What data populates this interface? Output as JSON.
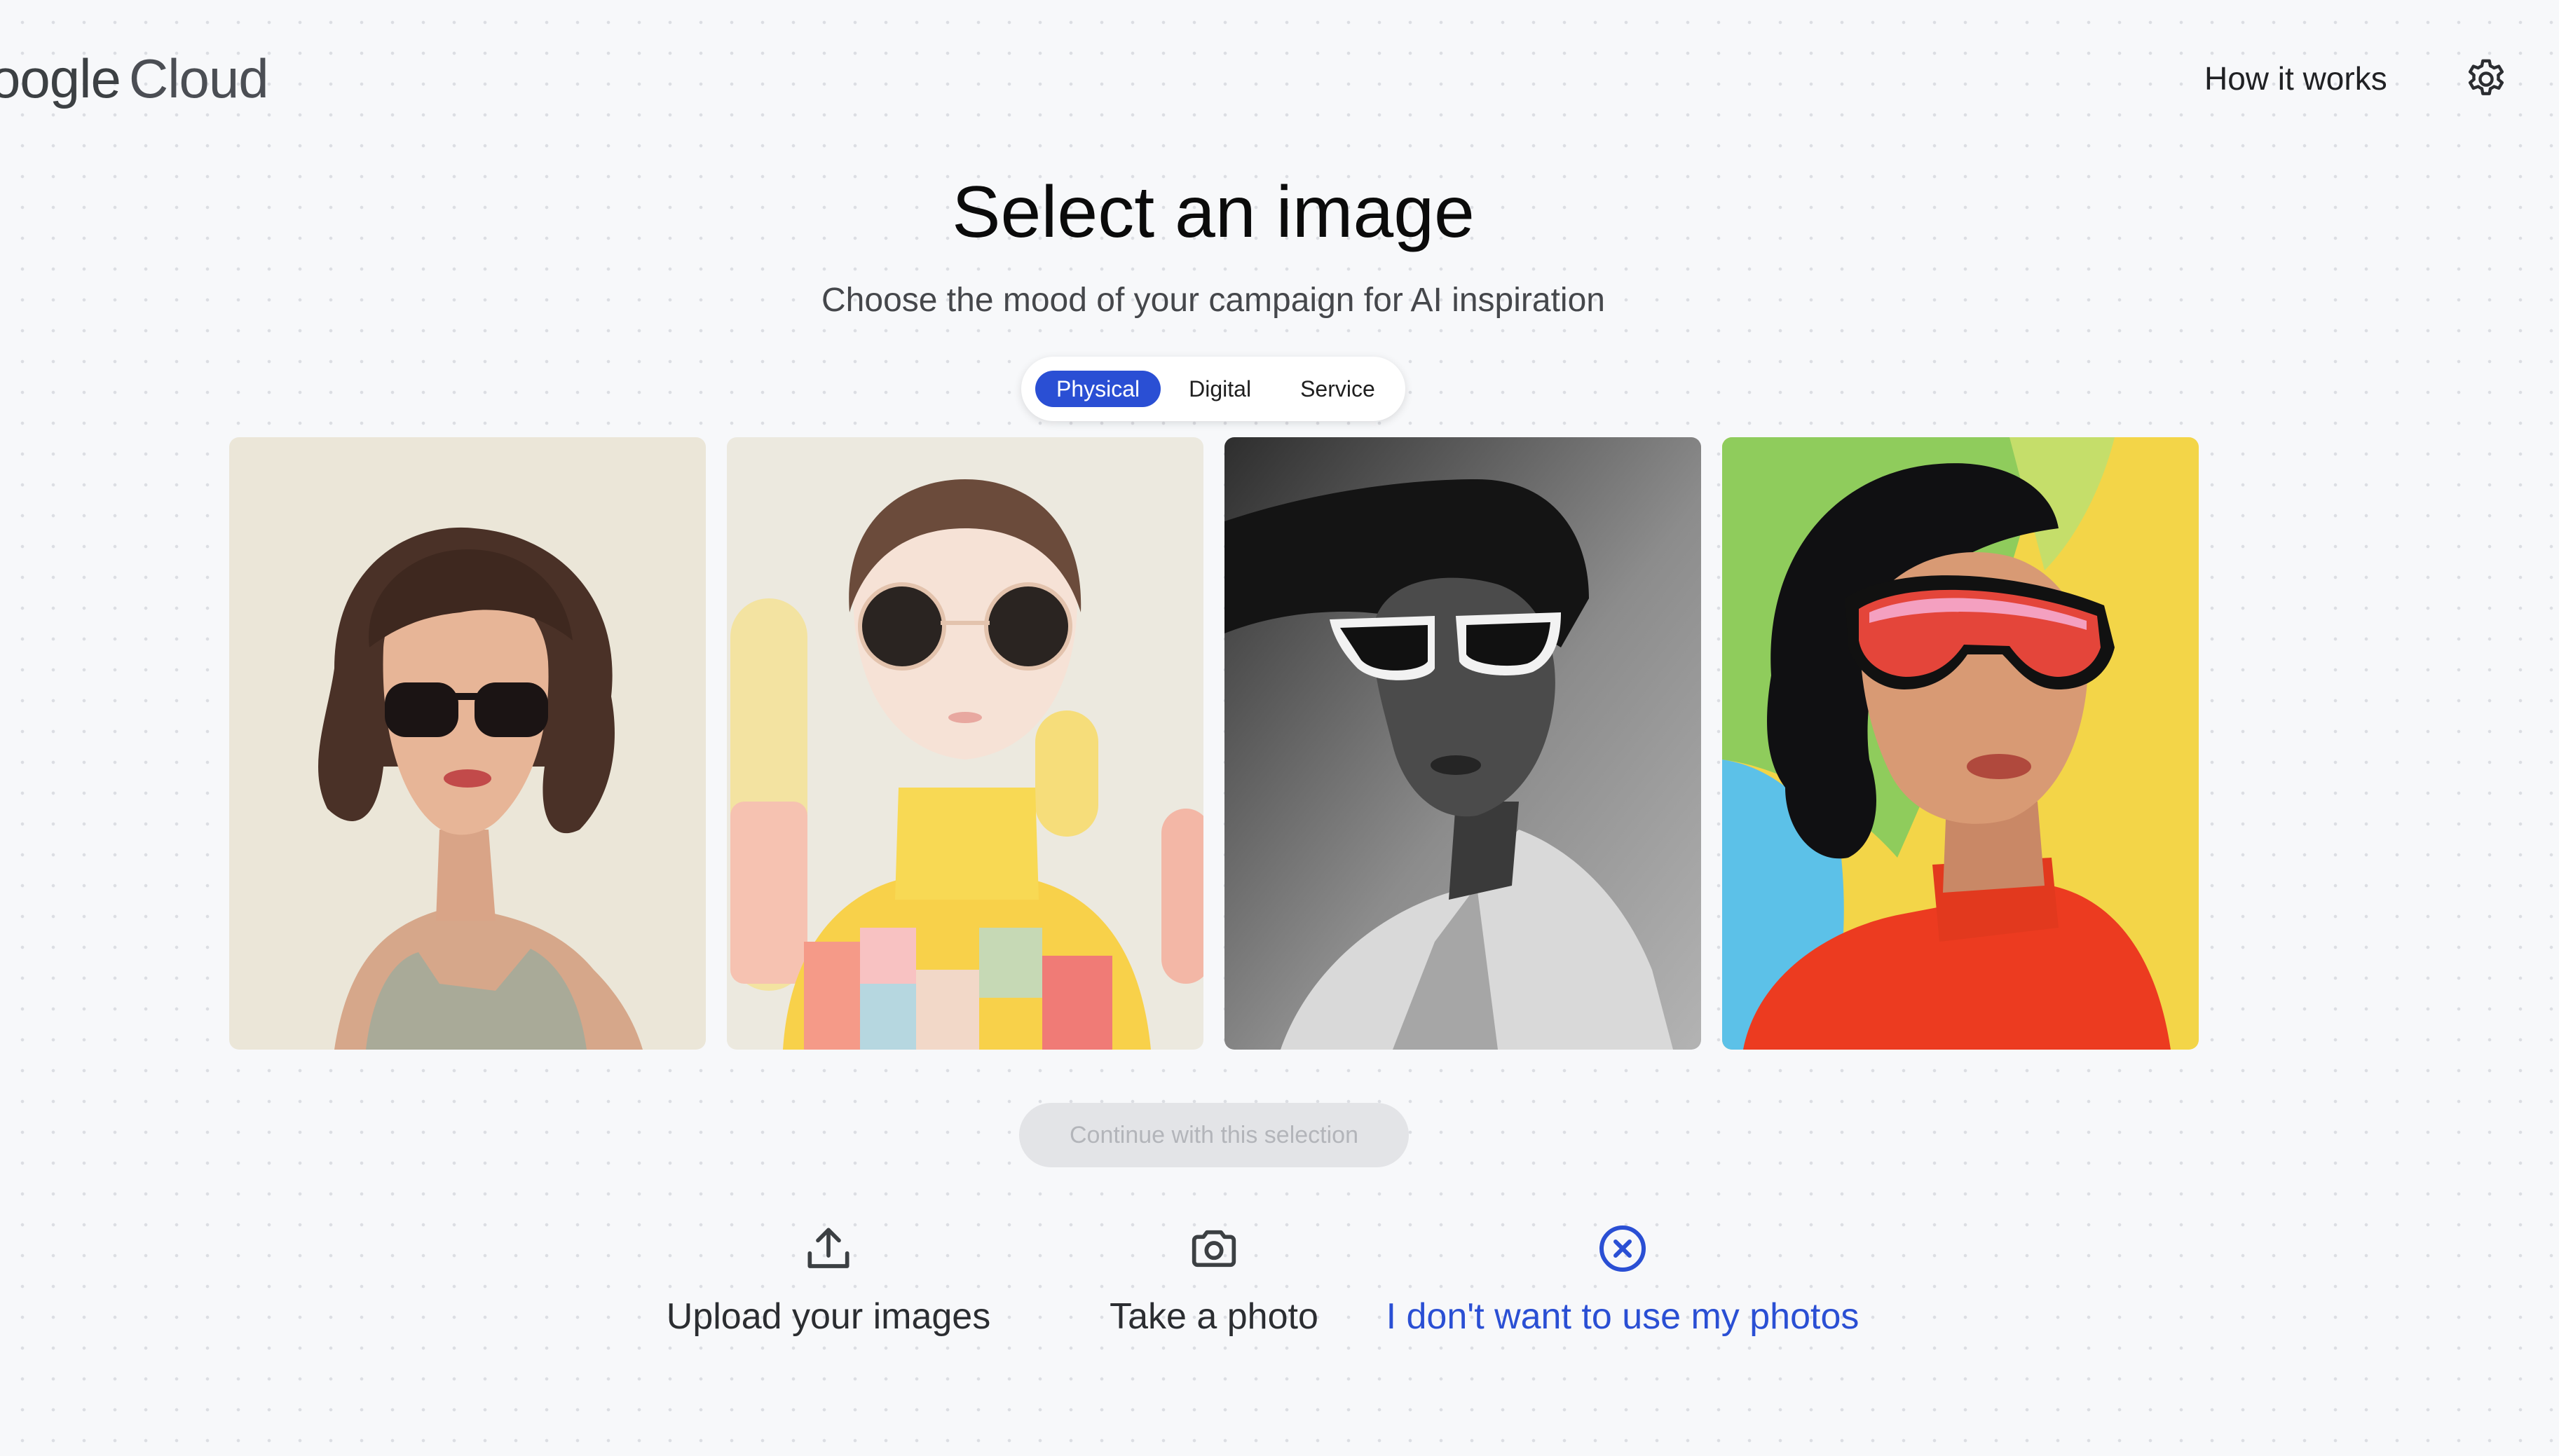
{
  "header": {
    "logo_google": "oogle",
    "logo_cloud": "Cloud",
    "how_it_works": "How it works",
    "settings_icon": "gear-icon"
  },
  "main": {
    "title": "Select an image",
    "subtitle": "Choose the mood of your campaign for AI inspiration",
    "tabs": [
      {
        "label": "Physical",
        "active": true
      },
      {
        "label": "Digital",
        "active": false
      },
      {
        "label": "Service",
        "active": false
      }
    ],
    "images": [
      {
        "name": "illustrated-woman-sunglasses",
        "alt": ""
      },
      {
        "name": "3d-figure-round-sunglasses",
        "alt": ""
      },
      {
        "name": "monochrome-portrait-white-sunglasses",
        "alt": ""
      },
      {
        "name": "colorful-portrait-red-visor",
        "alt": ""
      }
    ],
    "continue_label": "Continue with this selection"
  },
  "actions": [
    {
      "label": "Upload your images",
      "icon": "upload-icon"
    },
    {
      "label": "Take a photo",
      "icon": "camera-icon"
    },
    {
      "label": "I don't want to use my photos",
      "icon": "close-circle-icon"
    }
  ],
  "colors": {
    "accent": "#2a4fd4",
    "background": "#f7f8fa",
    "disabled_button": "#e3e4e7"
  }
}
